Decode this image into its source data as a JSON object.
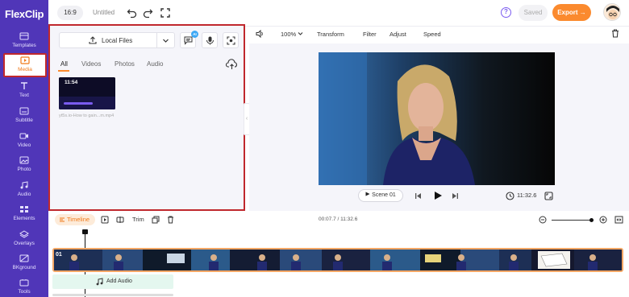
{
  "app": {
    "logo": "FlexClip",
    "logo_mark": "F"
  },
  "colors": {
    "rail": "#5036b8",
    "accent": "#fb8a2e",
    "highlight": "#c0282d"
  },
  "sidebar": {
    "items": [
      {
        "label": "Templates",
        "icon": "templates-icon"
      },
      {
        "label": "Media",
        "icon": "media-icon",
        "active": true
      },
      {
        "label": "Text",
        "icon": "text-icon"
      },
      {
        "label": "Subtitle",
        "icon": "subtitle-icon"
      },
      {
        "label": "Video",
        "icon": "video-icon"
      },
      {
        "label": "Photo",
        "icon": "photo-icon"
      },
      {
        "label": "Audio",
        "icon": "audio-icon"
      },
      {
        "label": "Elements",
        "icon": "elements-icon"
      },
      {
        "label": "Overlays",
        "icon": "overlays-icon"
      },
      {
        "label": "BKground",
        "icon": "background-icon"
      },
      {
        "label": "Tools",
        "icon": "tools-icon"
      }
    ]
  },
  "topbar": {
    "ratio": "16:9",
    "title": "Untitled",
    "help": "?",
    "saved": "Saved",
    "export": "Export →"
  },
  "media": {
    "local_files": "Local Files",
    "ai_badge": "AI",
    "tabs": [
      "All",
      "Videos",
      "Photos",
      "Audio"
    ],
    "active_tab": "All",
    "item": {
      "duration": "11:54",
      "name": "yt5s.io-How to gain...m.mp4"
    },
    "collapse": "‹"
  },
  "editor": {
    "zoom": "100%",
    "tools": [
      "Transform",
      "Filter",
      "Adjust",
      "Speed"
    ]
  },
  "player": {
    "scene": "Scene 01",
    "timecode": "11:32.6"
  },
  "timeline": {
    "label": "Timeline",
    "trim": "Trim",
    "time": "00:07.7 / 11:32.6",
    "zoom_level": 0.96,
    "clip_number": "01",
    "add_audio": "Add Audio"
  }
}
